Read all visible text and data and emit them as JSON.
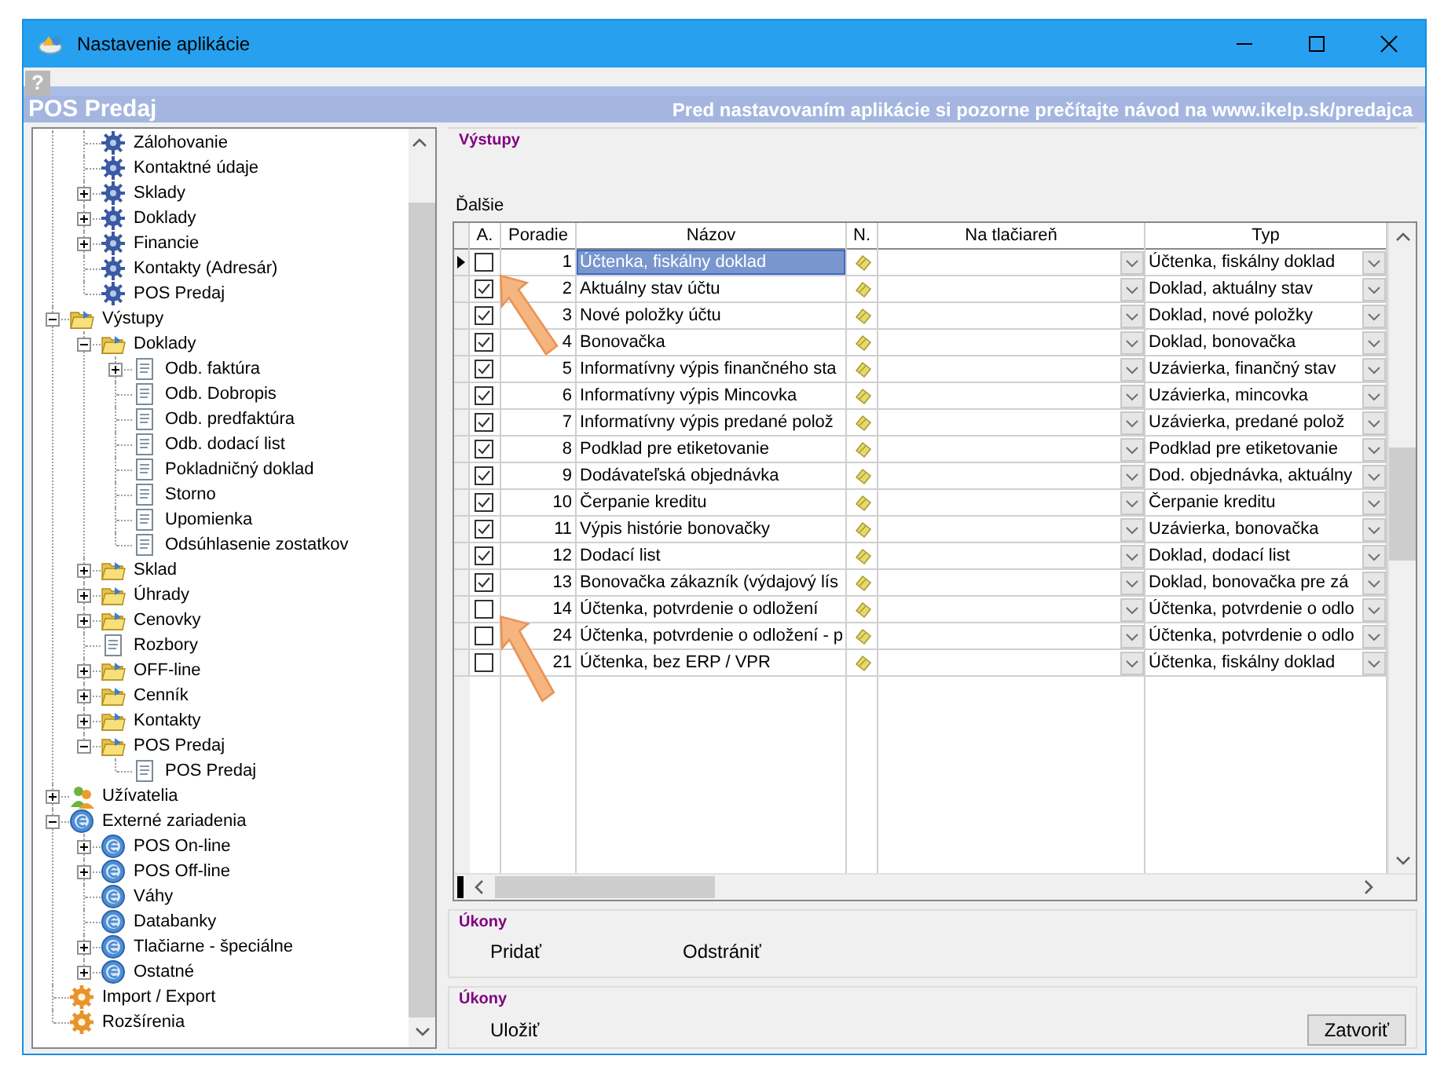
{
  "window": {
    "title": "Nastavenie aplikácie"
  },
  "help": "?",
  "header": {
    "title": "POS Predaj",
    "notice": "Pred nastavovaním aplikácie si pozorne prečítajte návod na www.ikelp.sk/predajca"
  },
  "tree": {
    "items": [
      {
        "children": [
          {
            "label": "Zálohovanie",
            "kind": "setting"
          },
          {
            "label": "Kontaktné údaje",
            "kind": "setting"
          },
          {
            "label": "Sklady",
            "kind": "setting",
            "expanded": false
          },
          {
            "label": "Doklady",
            "kind": "setting",
            "expanded": false
          },
          {
            "label": "Financie",
            "kind": "setting",
            "expanded": false
          },
          {
            "label": "Kontakty (Adresár)",
            "kind": "setting"
          },
          {
            "label": "POS Predaj",
            "kind": "setting"
          }
        ]
      },
      {
        "label": "Výstupy",
        "kind": "folder",
        "expanded": true,
        "children": [
          {
            "label": "Doklady",
            "kind": "folder",
            "expanded": true,
            "children": [
              {
                "label": "Odb. faktúra",
                "kind": "report",
                "expanded": false
              },
              {
                "label": "Odb. Dobropis",
                "kind": "report"
              },
              {
                "label": "Odb. predfaktúra",
                "kind": "report"
              },
              {
                "label": "Odb. dodací list",
                "kind": "report"
              },
              {
                "label": "Pokladničný doklad",
                "kind": "report"
              },
              {
                "label": "Storno",
                "kind": "report"
              },
              {
                "label": "Upomienka",
                "kind": "report"
              },
              {
                "label": "Odsúhlasenie zostatkov",
                "kind": "report"
              }
            ]
          },
          {
            "label": "Sklad",
            "kind": "folder",
            "expanded": false
          },
          {
            "label": "Úhrady",
            "kind": "folder",
            "expanded": false
          },
          {
            "label": "Cenovky",
            "kind": "folder",
            "expanded": false
          },
          {
            "label": "Rozbory",
            "kind": "report"
          },
          {
            "label": "OFF-line",
            "kind": "folder",
            "expanded": false
          },
          {
            "label": "Cenník",
            "kind": "folder",
            "expanded": false
          },
          {
            "label": "Kontakty",
            "kind": "folder",
            "expanded": false
          },
          {
            "label": "POS Predaj",
            "kind": "folder",
            "expanded": true,
            "children": [
              {
                "label": "POS Predaj",
                "kind": "report"
              }
            ]
          }
        ]
      },
      {
        "label": "Užívatelia",
        "kind": "users",
        "expanded": false
      },
      {
        "label": "Externé zariadenia",
        "kind": "device",
        "expanded": true,
        "children": [
          {
            "label": "POS On-line",
            "kind": "device",
            "expanded": false
          },
          {
            "label": "POS Off-line",
            "kind": "device",
            "expanded": false
          },
          {
            "label": "Váhy",
            "kind": "device"
          },
          {
            "label": "Databanky",
            "kind": "device"
          },
          {
            "label": "Tlačiarne - špeciálne",
            "kind": "device",
            "expanded": false
          },
          {
            "label": "Ostatné",
            "kind": "device",
            "expanded": false
          }
        ]
      },
      {
        "label": "Import / Export",
        "kind": "module"
      },
      {
        "label": "Rozšírenia",
        "kind": "module"
      }
    ]
  },
  "outputs": {
    "group_label": "Výstupy",
    "section_label": "Ďalšie"
  },
  "grid": {
    "columns": [
      "A.",
      "Poradie",
      "Názov",
      "N.",
      "Na tlačiareň",
      "Typ"
    ],
    "rows": [
      {
        "checked": false,
        "selected": true,
        "order": "1",
        "name": "Účtenka, fiskálny doklad",
        "type": "Účtenka, fiskálny doklad"
      },
      {
        "checked": true,
        "selected": false,
        "order": "2",
        "name": "Aktuálny stav účtu",
        "type": "Doklad, aktuálny stav"
      },
      {
        "checked": true,
        "selected": false,
        "order": "3",
        "name": "Nové položky účtu",
        "type": "Doklad, nové položky"
      },
      {
        "checked": true,
        "selected": false,
        "order": "4",
        "name": "Bonovačka",
        "type": "Doklad, bonovačka"
      },
      {
        "checked": true,
        "selected": false,
        "order": "5",
        "name": "Informatívny výpis finančného sta",
        "type": "Uzávierka, finančný stav"
      },
      {
        "checked": true,
        "selected": false,
        "order": "6",
        "name": "Informatívny výpis Mincovka",
        "type": "Uzávierka, mincovka"
      },
      {
        "checked": true,
        "selected": false,
        "order": "7",
        "name": "Informatívny výpis predané polož",
        "type": "Uzávierka, predané polož"
      },
      {
        "checked": true,
        "selected": false,
        "order": "8",
        "name": "Podklad pre etiketovanie",
        "type": "Podklad pre etiketovanie"
      },
      {
        "checked": true,
        "selected": false,
        "order": "9",
        "name": "Dodávateľská objednávka",
        "type": "Dod. objednávka, aktuálny"
      },
      {
        "checked": true,
        "selected": false,
        "order": "10",
        "name": "Čerpanie kreditu",
        "type": "Čerpanie kreditu"
      },
      {
        "checked": true,
        "selected": false,
        "order": "11",
        "name": "Výpis histórie bonovačky",
        "type": "Uzávierka, bonovačka"
      },
      {
        "checked": true,
        "selected": false,
        "order": "12",
        "name": "Dodací list",
        "type": "Doklad, dodací list"
      },
      {
        "checked": true,
        "selected": false,
        "order": "13",
        "name": "Bonovačka zákazník (výdajový lís",
        "type": "Doklad, bonovačka pre zá"
      },
      {
        "checked": false,
        "selected": false,
        "order": "14",
        "name": "Účtenka, potvrdenie o odložení",
        "type": "Účtenka, potvrdenie o odlo"
      },
      {
        "checked": false,
        "selected": false,
        "order": "24",
        "name": "Účtenka, potvrdenie o odložení - p",
        "type": "Účtenka, potvrdenie o odlo"
      },
      {
        "checked": false,
        "selected": false,
        "order": "21",
        "name": "Účtenka, bez ERP / VPR",
        "type": "Účtenka, fiskálny doklad"
      }
    ]
  },
  "row_actions": {
    "label": "Úkony",
    "buttons": [
      "Pridať",
      "Odstrániť"
    ]
  },
  "form_actions": {
    "label": "Úkony",
    "buttons": [
      {
        "label": "Uložiť",
        "kind": "flat"
      },
      {
        "label": "Zatvoriť",
        "kind": "raised"
      }
    ]
  }
}
